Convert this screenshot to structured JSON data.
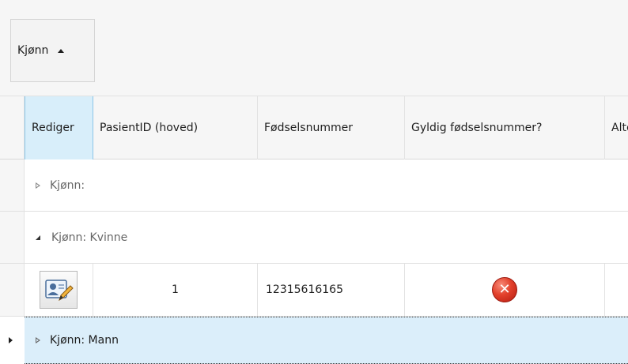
{
  "group_panel": {
    "chip_label": "Kjønn"
  },
  "columns": [
    {
      "label": "Rediger"
    },
    {
      "label": "PasientID (hoved)"
    },
    {
      "label": "Fødselsnummer"
    },
    {
      "label": "Gyldig fødselsnummer?"
    },
    {
      "label": "Alte"
    }
  ],
  "groups": [
    {
      "label": "Kjønn:"
    },
    {
      "label": "Kjønn: Kvinne"
    },
    {
      "label": "Kjønn: Mann"
    }
  ],
  "row": {
    "pasient_id": "1",
    "fodselsnummer": "12315616165",
    "valid_icon": "error-icon",
    "valid_symbol": "✕",
    "edit_icon": "edit-contact-icon"
  },
  "colors": {
    "selected_row": "#dbeefa",
    "active_header": "#d8eefa",
    "error": "#e2402b"
  }
}
